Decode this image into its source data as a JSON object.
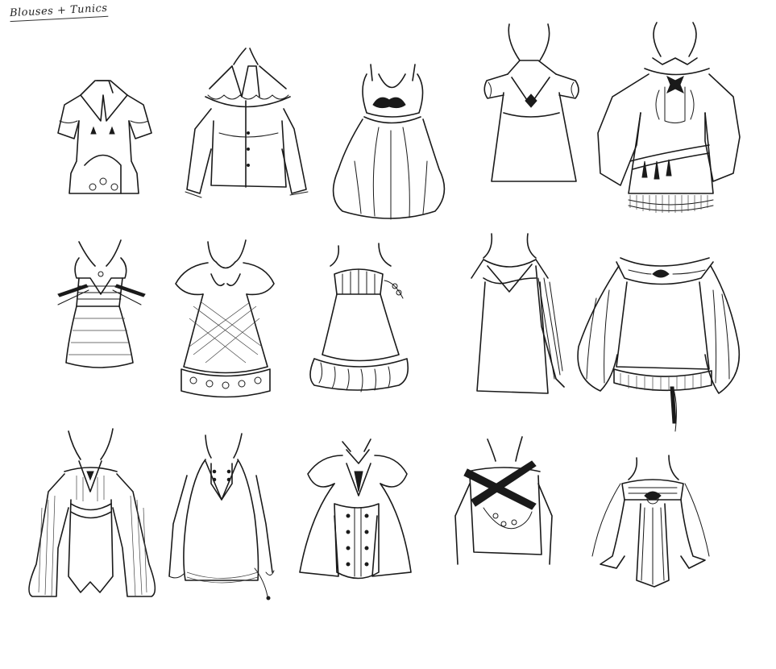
{
  "sheet": {
    "title": "Blouses + Tunics",
    "line_color": "#1a1a1a",
    "background": "#ffffff",
    "rows": 3,
    "columns": 5
  }
}
